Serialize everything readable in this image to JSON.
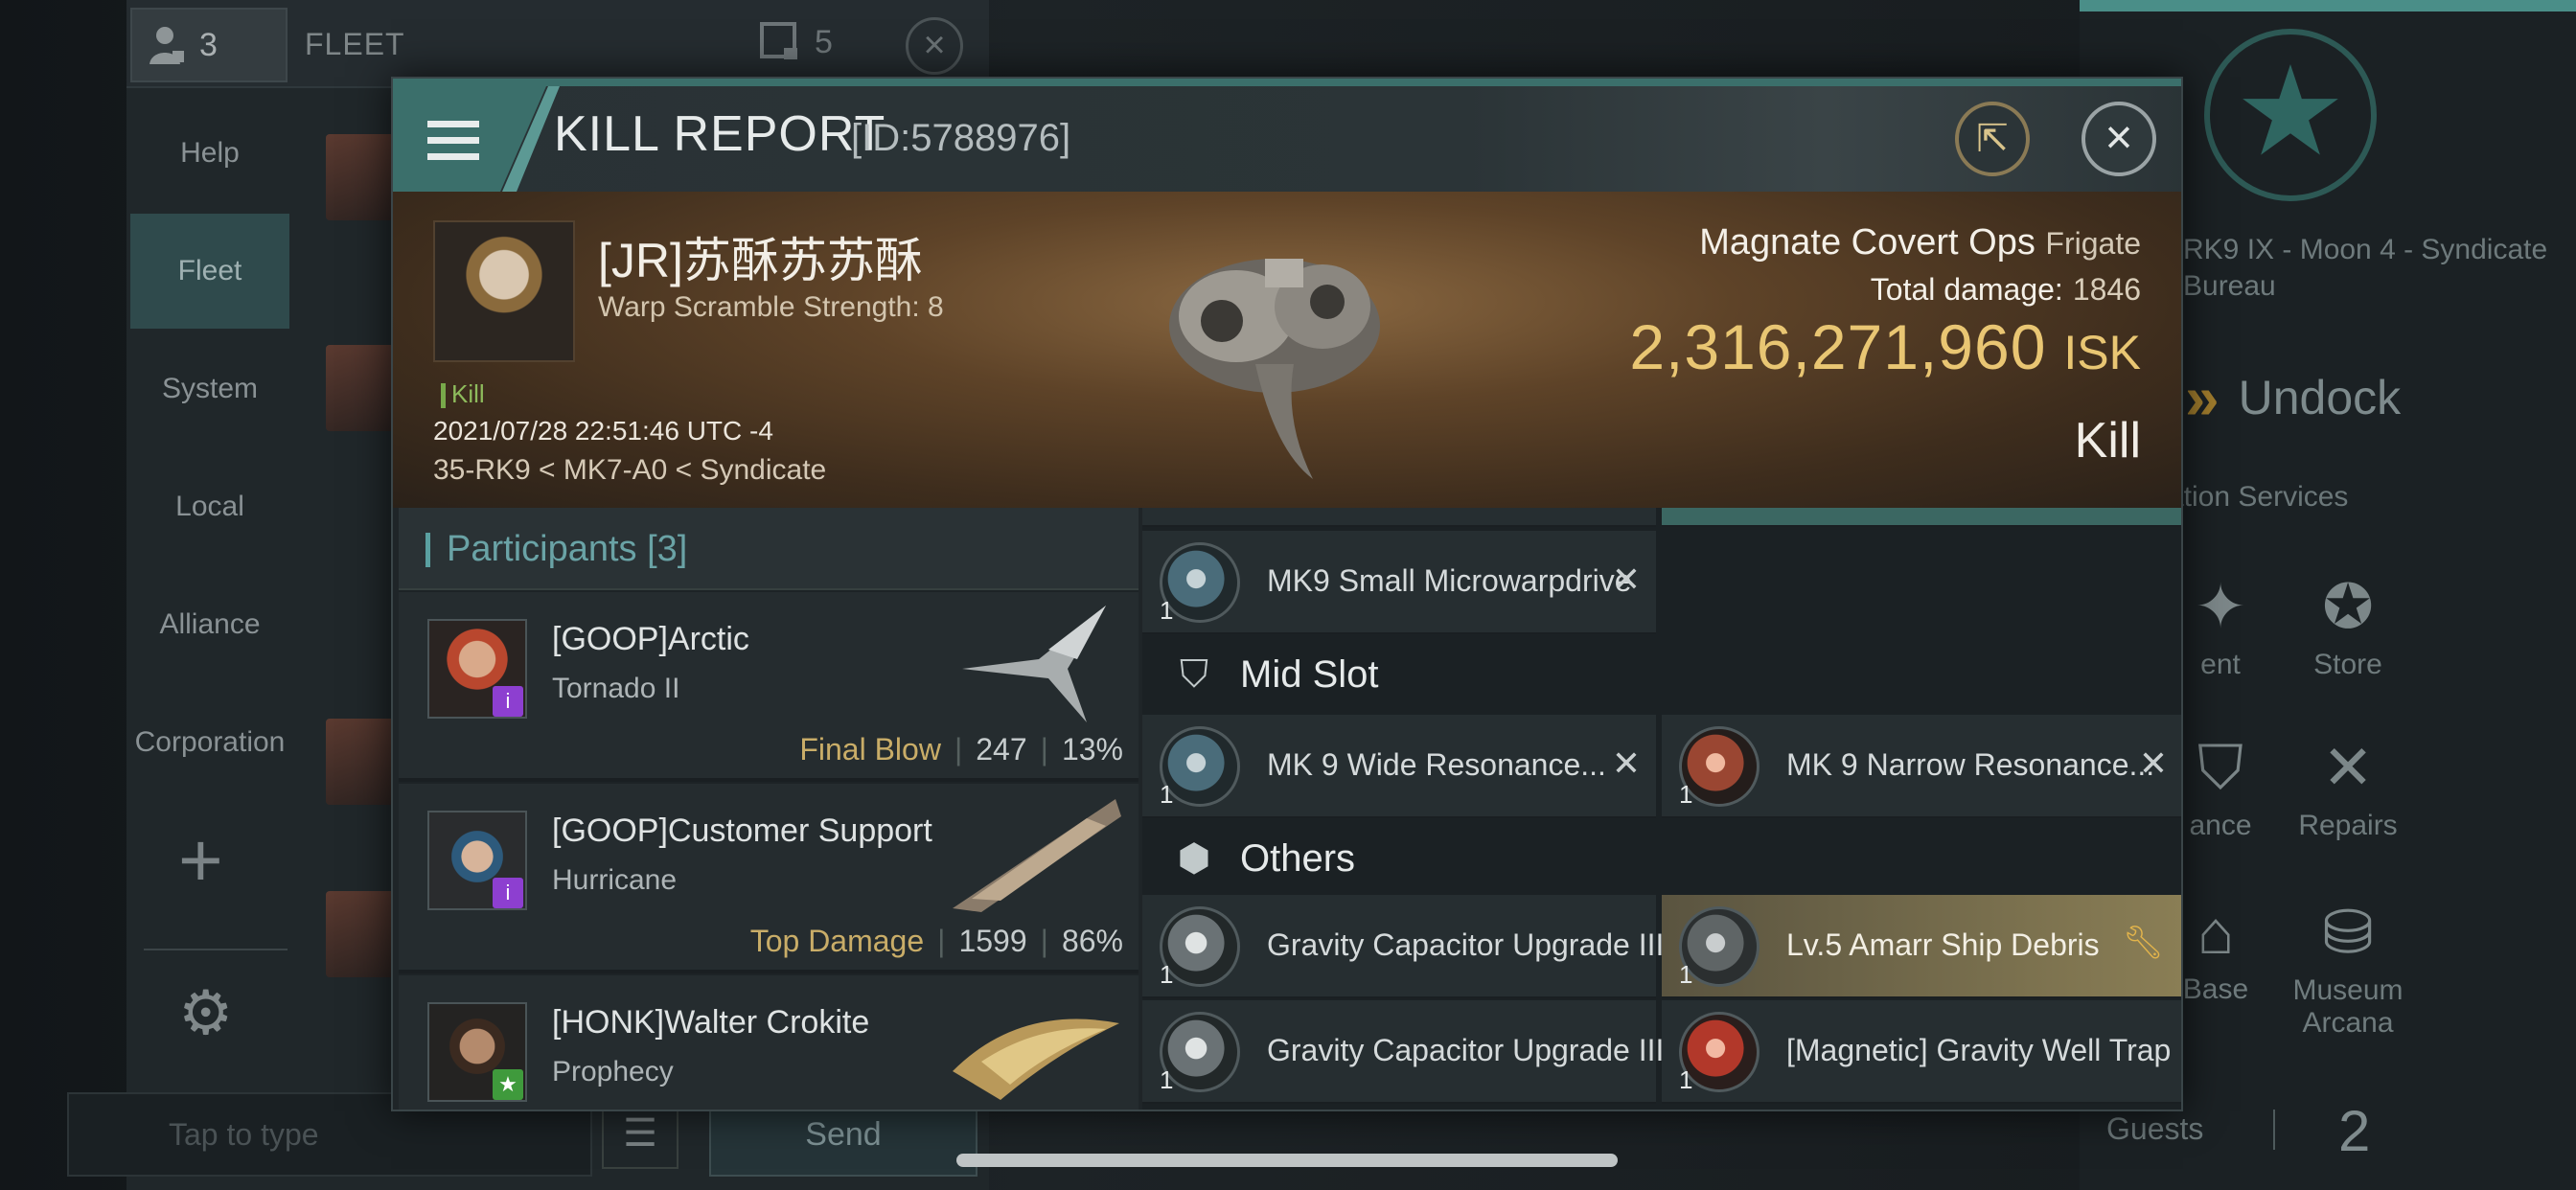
{
  "background": {
    "member_count": "3",
    "fleet_label": "FLEET",
    "fleet_count": "5",
    "sidebar": [
      "Help",
      "Fleet",
      "System",
      "Local",
      "Alliance",
      "Corporation"
    ],
    "chat_placeholder": "Tap to type",
    "send_label": "Send",
    "station_name": "RK9 IX - Moon 4 - Syndicate Bureau",
    "undock_label": "Undock",
    "services_label": "ation Services",
    "services": [
      {
        "label": "ent",
        "icon": "sparkle-icon"
      },
      {
        "label": "Store",
        "icon": "store-icon"
      },
      {
        "label": "ance",
        "icon": "insurance-icon"
      },
      {
        "label": "Repairs",
        "icon": "repairs-icon"
      },
      {
        "label": "Base",
        "icon": "base-icon"
      },
      {
        "label": "Museum Arcana",
        "icon": "museum-icon"
      }
    ],
    "guests_label": "Guests",
    "guests_count": "2"
  },
  "modal": {
    "title": "KILL REPORT",
    "report_id": "[ID:5788976]",
    "victim": {
      "name": "[JR]苏酥苏苏酥",
      "warp_scramble": "Warp Scramble Strength: 8",
      "kill_tag": "Kill",
      "datetime": "2021/07/28 22:51:46 UTC -4",
      "location": "35-RK9 < MK7-A0 < Syndicate",
      "ship_name": "Magnate Covert Ops",
      "ship_class": "Frigate",
      "total_damage_label": "Total damage:",
      "total_damage_value": "1846",
      "isk_value": "2,316,271,960",
      "isk_unit": "ISK",
      "result": "Kill"
    },
    "participants_title": "Participants",
    "participants_count": "[3]",
    "participants": [
      {
        "name": "[GOOP]Arctic",
        "ship": "Tornado II",
        "tag": "Final Blow",
        "damage": "247",
        "percent": "13%",
        "badge_color": "#8d3fd0"
      },
      {
        "name": "[GOOP]Customer Support",
        "ship": "Hurricane",
        "tag": "Top Damage",
        "damage": "1599",
        "percent": "86%",
        "badge_color": "#8d3fd0"
      },
      {
        "name": "[HONK]Walter Crokite",
        "ship": "Prophecy",
        "tag": "",
        "damage": "",
        "percent": "",
        "badge_color": "#3f9a3c"
      }
    ],
    "fitting": {
      "partial_qty_left": "1",
      "partial_qty_right": "1",
      "low_slot_item": {
        "qty": "1",
        "name": "MK9 Small Microwarpdrive"
      },
      "mid_slot_label": "Mid Slot",
      "mid_slot_items": [
        {
          "qty": "1",
          "name": "MK 9 Wide Resonance..."
        },
        {
          "qty": "1",
          "name": "MK 9 Narrow Resonance..."
        }
      ],
      "others_label": "Others",
      "others_items": [
        {
          "qty": "1",
          "name": "Gravity Capacitor Upgrade III"
        },
        {
          "qty": "1",
          "name": "Lv.5 Amarr Ship Debris"
        },
        {
          "qty": "1",
          "name": "Gravity Capacitor Upgrade III"
        },
        {
          "qty": "1",
          "name": "[Magnetic] Gravity Well Trap"
        }
      ]
    }
  }
}
